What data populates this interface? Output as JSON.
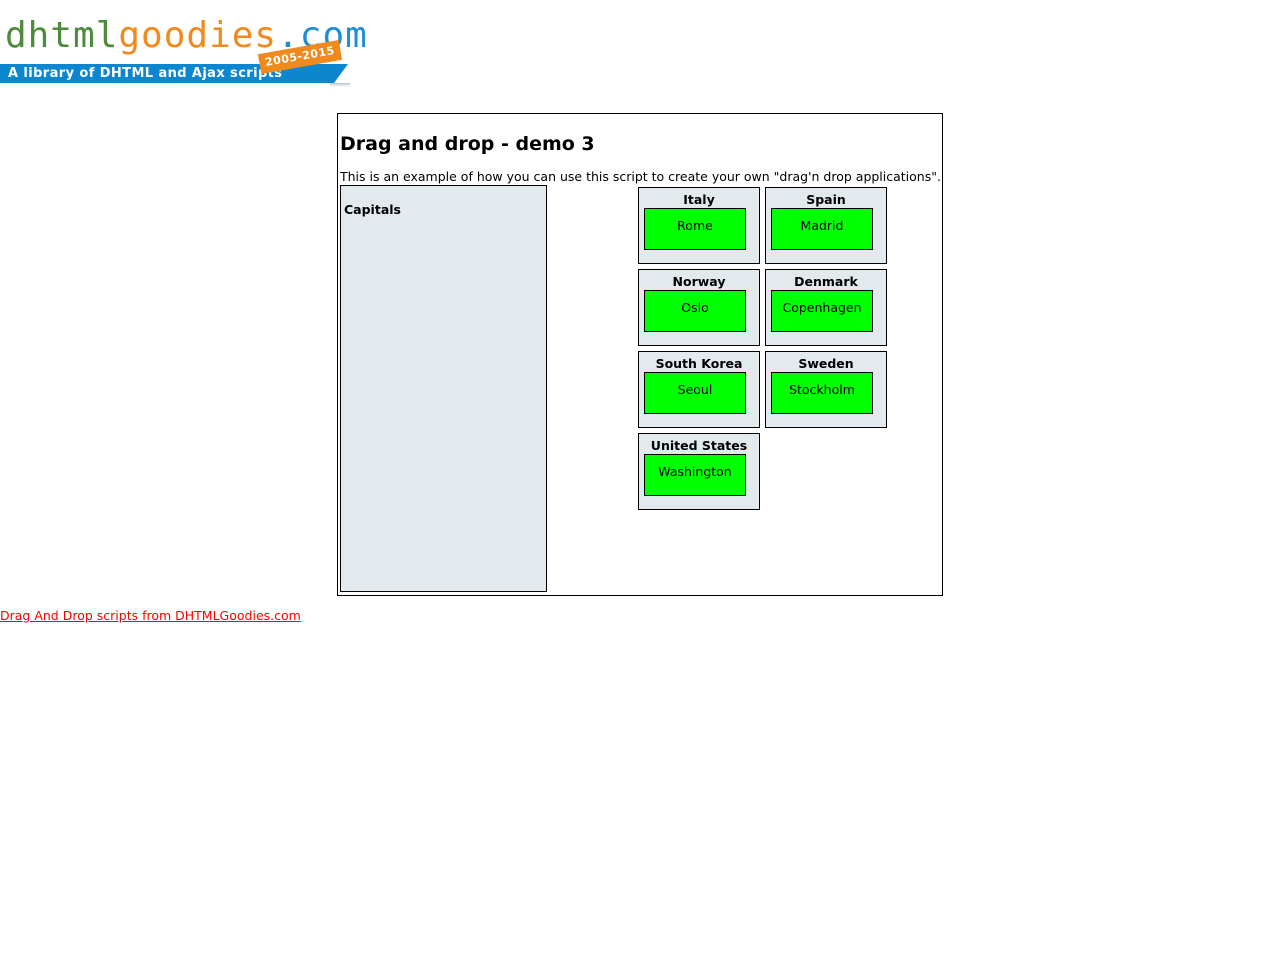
{
  "logo": {
    "part_dhtml": "dhtml",
    "part_goodies": "goodies",
    "part_com": ".com",
    "tagline": "A library of DHTML and Ajax scripts",
    "years": "2005-2015"
  },
  "colors": {
    "logo_green": "#4b8b3b",
    "logo_orange": "#f08a1c",
    "logo_blue": "#0d86d0",
    "panel_background": "#e2eaed",
    "capital_item": "#00ff00",
    "footer_link": "#ff0000"
  },
  "demo": {
    "title": "Drag and drop - demo 3",
    "intro": "This is an example of how you can use this script to create your own \"drag'n drop applications\".",
    "capitals_label": "Capitals",
    "countries": [
      {
        "name": "Italy",
        "capital": "Rome"
      },
      {
        "name": "Spain",
        "capital": "Madrid"
      },
      {
        "name": "Norway",
        "capital": "Oslo"
      },
      {
        "name": "Denmark",
        "capital": "Copenhagen"
      },
      {
        "name": "South Korea",
        "capital": "Seoul"
      },
      {
        "name": "Sweden",
        "capital": "Stockholm"
      },
      {
        "name": "United States",
        "capital": "Washington"
      }
    ]
  },
  "footer": {
    "link_text": "Drag And Drop scripts from DHTMLGoodies.com"
  }
}
